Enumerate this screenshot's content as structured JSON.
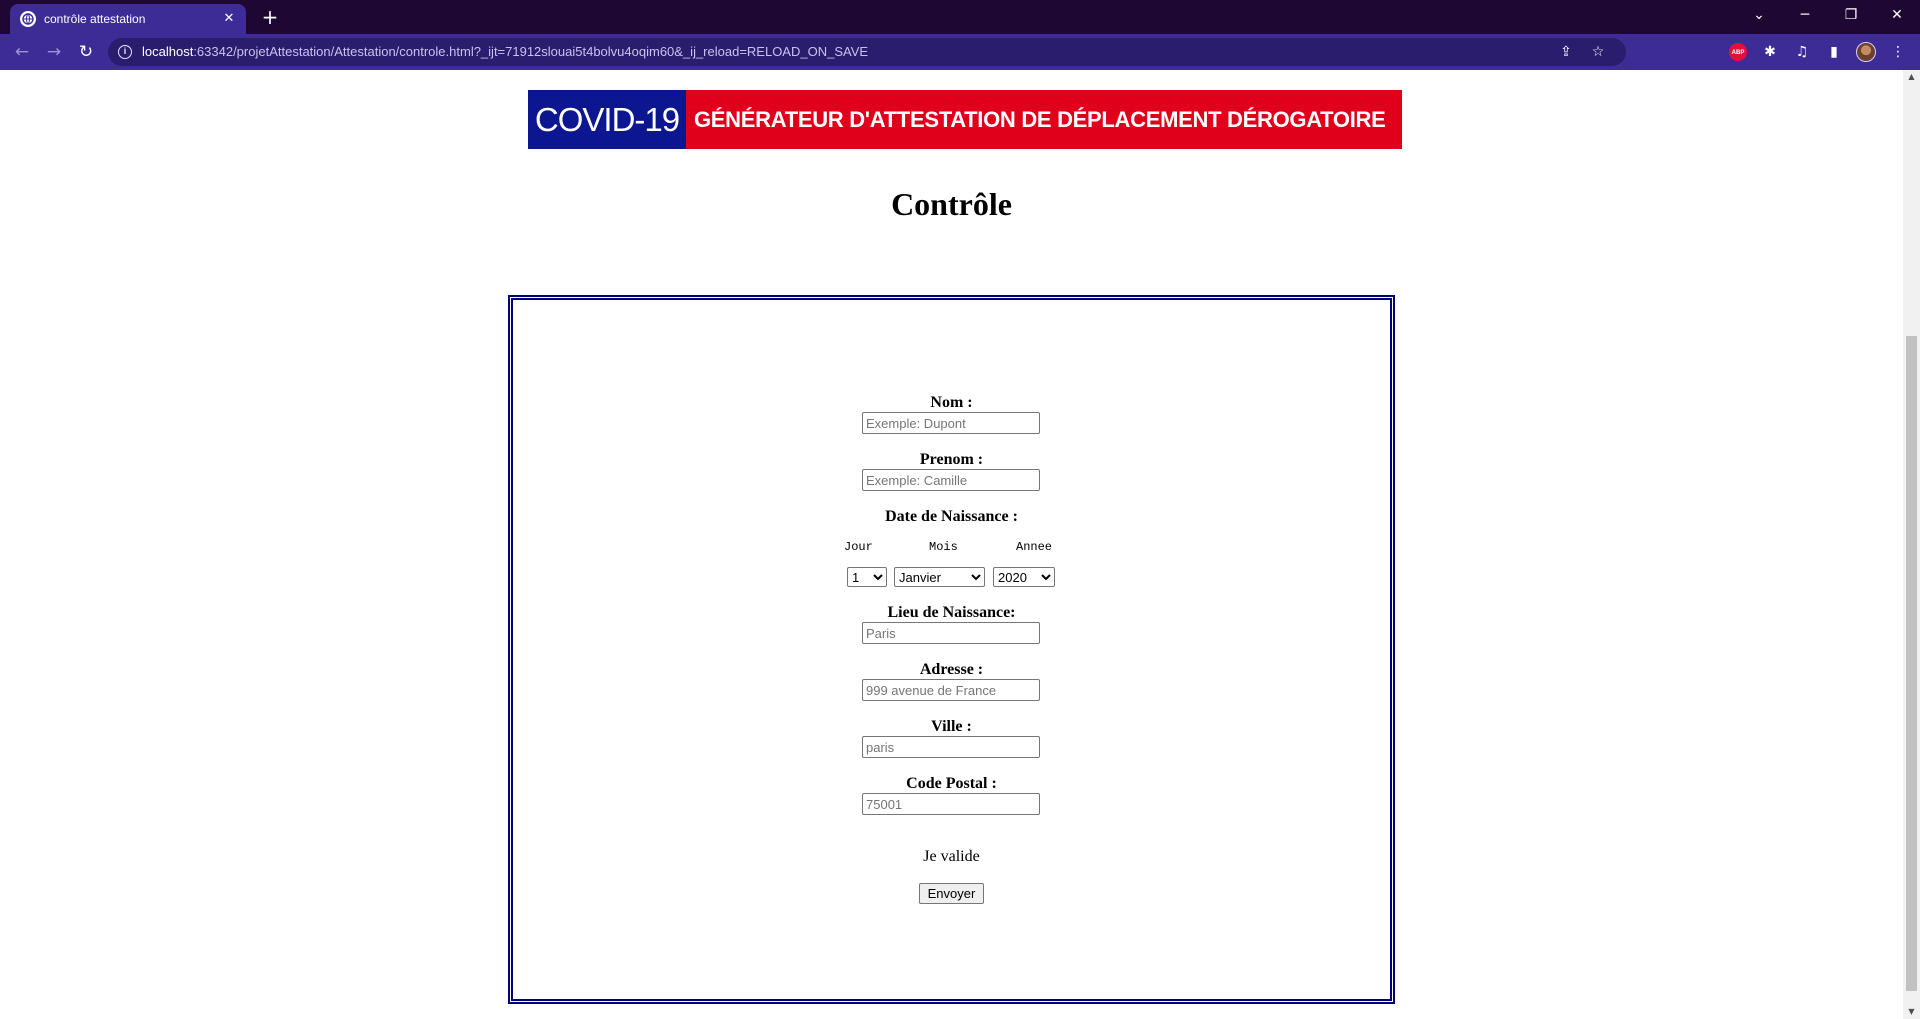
{
  "browser": {
    "tab_title": "contrôle attestation",
    "tab_close": "✕",
    "new_tab": "+",
    "url_host": "localhost",
    "url_rest": ":63342/projetAttestation/Attestation/controle.html?_ijt=71912slouai5t4bolvu4oqim60&_ij_reload=RELOAD_ON_SAVE",
    "info_glyph": "i",
    "window_controls": {
      "dropdown": "⌄",
      "minimize": "─",
      "restore": "❐",
      "close": "✕"
    },
    "nav": {
      "back": "←",
      "forward": "→",
      "reload": "↻"
    },
    "omnibox_icons": {
      "share": "⇪",
      "bookmark": "☆"
    },
    "toolbar_icons": {
      "adblock": "ABP",
      "extensions": "✱",
      "media": "♫",
      "sidepanel": "▮",
      "menu": "⋮"
    }
  },
  "banner": {
    "left_text": "COVID-19",
    "right_text": "GÉNÉRATEUR D'ATTESTATION DE DÉPLACEMENT DÉROGATOIRE",
    "colors": {
      "left_bg": "#0b1690",
      "right_bg": "#e1001b"
    }
  },
  "page": {
    "title": "Contrôle"
  },
  "form": {
    "nom": {
      "label": "Nom :",
      "placeholder": "Exemple: Dupont"
    },
    "prenom": {
      "label": "Prenom :",
      "placeholder": "Exemple: Camille"
    },
    "date_naissance": {
      "label": "Date de Naissance :",
      "jour_label": "Jour",
      "mois_label": "Mois",
      "annee_label": "Annee",
      "jour_value": "1",
      "mois_value": "Janvier",
      "annee_value": "2020"
    },
    "lieu_naissance": {
      "label": "Lieu de Naissance:",
      "placeholder": "Paris"
    },
    "adresse": {
      "label": "Adresse :",
      "placeholder": "999 avenue de France"
    },
    "ville": {
      "label": "Ville :",
      "placeholder": "paris"
    },
    "code_postal": {
      "label": "Code Postal :",
      "placeholder": "75001"
    },
    "valid_text": "Je valide",
    "submit_label": "Envoyer",
    "border_color": "#00007a"
  },
  "scrollbar": {
    "up": "▲",
    "down": "▼"
  }
}
